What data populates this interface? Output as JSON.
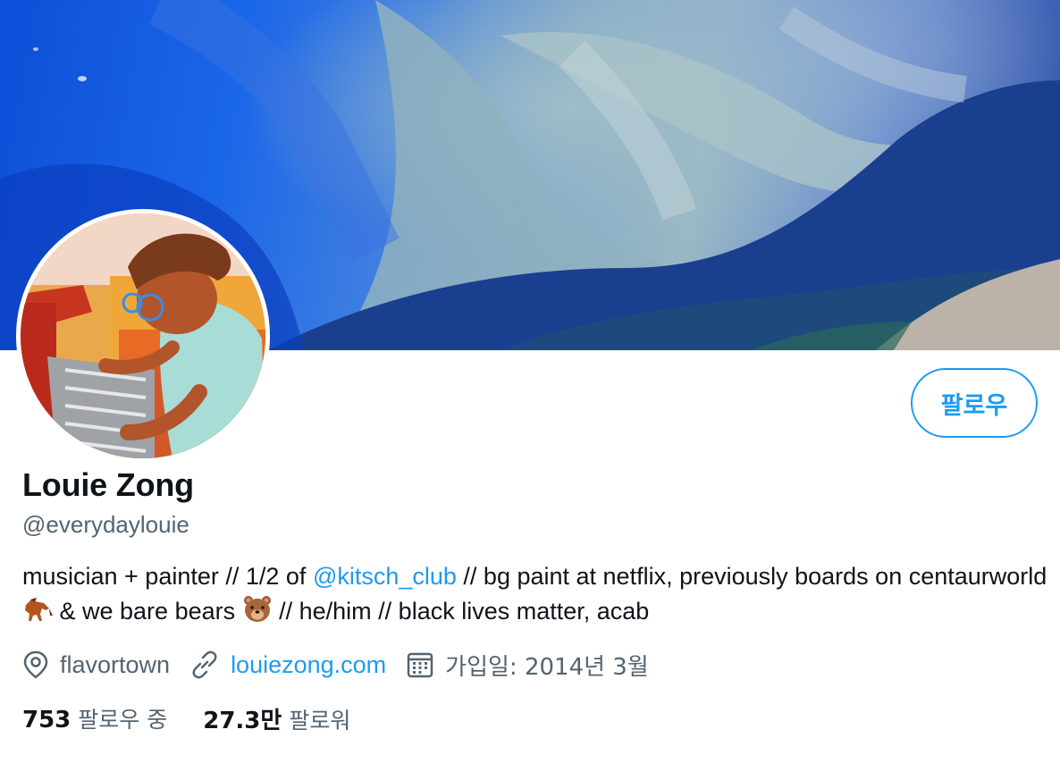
{
  "profile": {
    "display_name": "Louie Zong",
    "handle": "@everydaylouie",
    "follow_label": "팔로우",
    "bio": {
      "part1": "musician + painter // 1/2 of ",
      "mention": "@kitsch_club",
      "part2": " // bg paint at netflix, previously boards on centaurworld ",
      "part3": " & we bare bears ",
      "part4": " // he/him // black lives matter, acab",
      "emoji1": "horse-emoji",
      "emoji2": "bear-emoji"
    },
    "location": "flavortown",
    "website": "louiezong.com",
    "joined": "가입일: 2014년 3월",
    "following_count": "753",
    "following_label": "팔로우 중",
    "followers_count": "27.3만",
    "followers_label": "팔로워"
  },
  "icons": {
    "location": "location-pin-icon",
    "link": "link-icon",
    "calendar": "calendar-icon"
  },
  "colors": {
    "accent": "#1d9bf0",
    "secondary_text": "#536471",
    "primary_text": "#0f1419"
  }
}
